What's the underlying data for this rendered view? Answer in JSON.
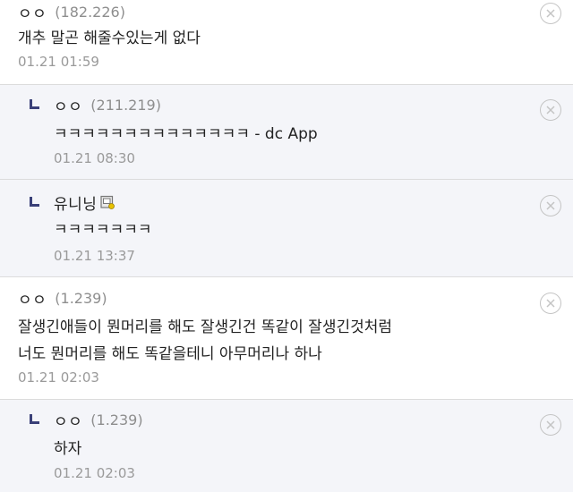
{
  "comments": [
    {
      "nick": "ㅇㅇ",
      "ip": "(182.226)",
      "lines": [
        "개추 말곤 해줄수있는게 없다"
      ],
      "date": "01.21 01:59"
    },
    {
      "nick": "ㅇㅇ",
      "ip": "(211.219)",
      "lines": [
        "ㅋㅋㅋㅋㅋㅋㅋㅋㅋㅋㅋㅋㅋㅋ - dc App"
      ],
      "date": "01.21 08:30"
    },
    {
      "nick": "유니닝",
      "ip": "",
      "lines": [
        "ㅋㅋㅋㅋㅋㅋㅋ"
      ],
      "date": "01.21 13:37",
      "badge_icon": "fixed-nick-icon"
    },
    {
      "nick": "ㅇㅇ",
      "ip": "(1.239)",
      "lines": [
        "잘생긴애들이 뭔머리를 해도 잘생긴건 똑같이 잘생긴것처럼",
        "너도 뭔머리를 해도 똑같을테니 아무머리나 하나"
      ],
      "date": "01.21 02:03"
    },
    {
      "nick": "ㅇㅇ",
      "ip": "(1.239)",
      "lines": [
        "하자"
      ],
      "date": "01.21 02:03"
    }
  ],
  "icons": {
    "delete": "delete-circle-x-icon",
    "reply": "reply-arrow-icon"
  },
  "colors": {
    "reply_background": "#f4f5f9",
    "reply_marker": "#3a4078",
    "meta_text": "#8e8e8e"
  }
}
